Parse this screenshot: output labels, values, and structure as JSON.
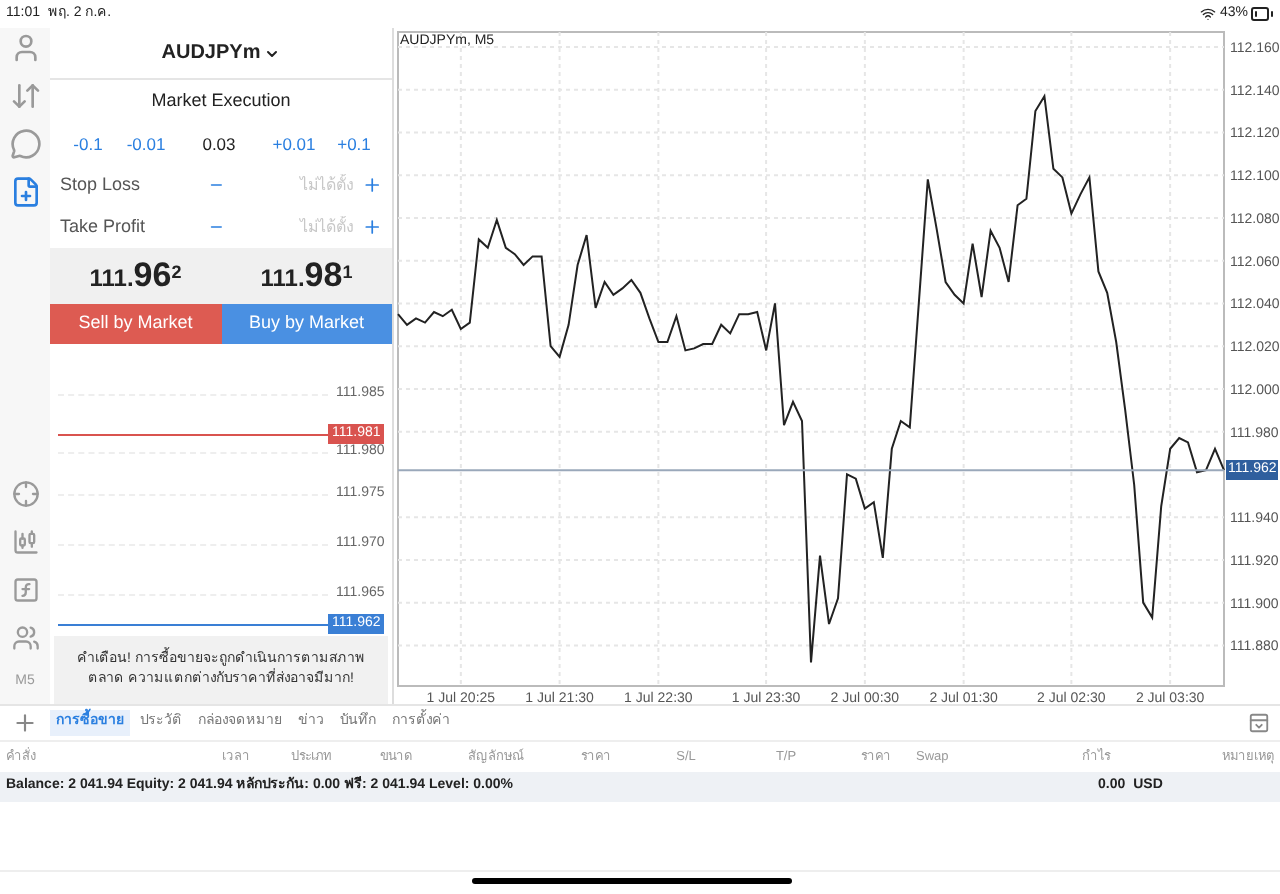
{
  "status_bar": {
    "time": "11:01",
    "date": "พฤ. 2 ก.ค.",
    "battery": "43%"
  },
  "sidebar": {
    "items": [
      {
        "kind": "account",
        "selected": false
      },
      {
        "kind": "trade",
        "selected": false
      },
      {
        "kind": "chat",
        "selected": false
      },
      {
        "kind": "new_order",
        "selected": true
      }
    ],
    "tools": [
      {
        "kind": "crosshair"
      },
      {
        "kind": "candles"
      },
      {
        "kind": "function"
      },
      {
        "kind": "objects"
      },
      {
        "kind": "timeframe",
        "label": "M5"
      }
    ]
  },
  "order": {
    "symbol": "AUDJPYm",
    "execution": "Market Execution",
    "volume": [
      {
        "label": "-0.1",
        "kind": "step"
      },
      {
        "label": "-0.01",
        "kind": "step"
      },
      {
        "label": "0.03",
        "kind": "value"
      },
      {
        "label": "+0.01",
        "kind": "step"
      },
      {
        "label": "+0.1",
        "kind": "step"
      }
    ],
    "fields": [
      {
        "label": "Stop Loss",
        "placeholder": "ไม่ได้ตั้ง"
      },
      {
        "label": "Take Profit",
        "placeholder": "ไม่ได้ตั้ง"
      }
    ],
    "prices": [
      {
        "head": "111.",
        "big": "96",
        "sup": "2"
      },
      {
        "head": "111.",
        "big": "98",
        "sup": "1"
      }
    ],
    "buttons": [
      {
        "label": "Sell by Market",
        "kind": "sell"
      },
      {
        "label": "Buy by Market",
        "kind": "buy"
      }
    ],
    "mini_chart": {
      "ticks": [
        "111.985",
        "111.980",
        "111.975",
        "111.970",
        "111.965"
      ],
      "ask": "111.981",
      "bid": "111.962"
    },
    "warning": "คำเตือน! การซื้อขายจะถูกดำเนินการตามสภาพตลาด ความแตกต่างกับราคาที่ส่งอาจมีมาก!"
  },
  "chart": {
    "title": "AUDJPYm, M5",
    "chart_data": {
      "type": "line",
      "grid": true,
      "ylim": [
        111.861,
        112.167
      ],
      "categories": [
        null,
        null,
        null,
        null,
        null,
        null,
        null,
        "1 Jul 20:25",
        null,
        null,
        null,
        null,
        null,
        null,
        null,
        null,
        null,
        null,
        "1 Jul 21:30",
        null,
        null,
        null,
        null,
        null,
        null,
        null,
        null,
        null,
        null,
        "1 Jul 22:30",
        null,
        null,
        null,
        null,
        null,
        null,
        null,
        null,
        null,
        null,
        null,
        "1 Jul 23:30",
        null,
        null,
        null,
        null,
        null,
        null,
        null,
        null,
        null,
        null,
        "2 Jul 00:30",
        null,
        null,
        null,
        null,
        null,
        null,
        null,
        null,
        null,
        null,
        "2 Jul 01:30",
        null,
        null,
        null,
        null,
        null,
        null,
        null,
        null,
        null,
        null,
        null,
        "2 Jul 02:30",
        null,
        null,
        null,
        null,
        null,
        null,
        null,
        null,
        null,
        null,
        "2 Jul 03:30",
        null,
        null,
        null,
        null,
        null,
        null
      ],
      "yticks": [
        {
          "value": 111.88,
          "label": "111.880"
        },
        {
          "value": 111.9,
          "label": "111.900"
        },
        {
          "value": 111.92,
          "label": "111.920"
        },
        {
          "value": 111.94,
          "label": "111.940"
        },
        {
          "value": 111.98,
          "label": "111.980"
        },
        {
          "value": 112.0,
          "label": "112.000"
        },
        {
          "value": 112.02,
          "label": "112.020"
        },
        {
          "value": 112.04,
          "label": "112.040"
        },
        {
          "value": 112.06,
          "label": "112.060"
        },
        {
          "value": 112.08,
          "label": "112.080"
        },
        {
          "value": 112.1,
          "label": "112.100"
        },
        {
          "value": 112.12,
          "label": "112.120"
        },
        {
          "value": 112.14,
          "label": "112.140"
        },
        {
          "value": 112.16,
          "label": "112.160"
        }
      ],
      "series": [
        {
          "color": "#222222",
          "values": [
            112.035,
            112.03,
            112.033,
            112.031,
            112.036,
            112.034,
            112.037,
            112.028,
            112.031,
            112.07,
            112.066,
            112.079,
            112.066,
            112.063,
            112.058,
            112.062,
            112.062,
            112.02,
            112.015,
            112.03,
            112.058,
            112.072,
            112.038,
            112.05,
            112.044,
            112.047,
            112.051,
            112.045,
            112.033,
            112.022,
            112.022,
            112.034,
            112.018,
            112.019,
            112.021,
            112.021,
            112.03,
            112.026,
            112.035,
            112.035,
            112.036,
            112.018,
            112.04,
            111.983,
            111.994,
            111.985,
            111.872,
            111.922,
            111.89,
            111.902,
            111.96,
            111.958,
            111.944,
            111.947,
            111.921,
            111.972,
            111.985,
            111.982,
            112.04,
            112.098,
            112.075,
            112.05,
            112.044,
            112.04,
            112.068,
            112.043,
            112.074,
            112.066,
            112.05,
            112.086,
            112.089,
            112.13,
            112.137,
            112.103,
            112.099,
            112.082,
            112.091,
            112.099,
            112.055,
            112.045,
            112.022,
            111.99,
            111.955,
            111.9,
            111.893,
            111.945,
            111.972,
            111.977,
            111.975,
            111.961,
            111.962,
            111.972,
            111.962
          ]
        }
      ],
      "ref_lines": [
        {
          "axis": "y",
          "value": 111.962,
          "label": "111.962"
        }
      ]
    }
  },
  "tabs": [
    {
      "label": "การซื้อขาย",
      "selected": true
    },
    {
      "label": "ประวัติ",
      "selected": false
    },
    {
      "label": "กล่องจดหมาย",
      "selected": false
    },
    {
      "label": "ข่าว",
      "selected": false
    },
    {
      "label": "บันทึก",
      "selected": false
    },
    {
      "label": "การตั้งค่า",
      "selected": false
    }
  ],
  "table": {
    "columns": [
      "คำสั่ง",
      "เวลา",
      "ประเภท",
      "ขนาด",
      "สัญลักษณ์",
      "ราคา",
      "S/L",
      "T/P",
      "ราคา",
      "Swap",
      "กำไร",
      "หมายเหตุ"
    ],
    "summary": "Balance: 2 041.94 Equity: 2 041.94 หลักประกัน: 0.00 ฟรี: 2 041.94 Level: 0.00%",
    "profit": "0.00",
    "currency": "USD"
  }
}
